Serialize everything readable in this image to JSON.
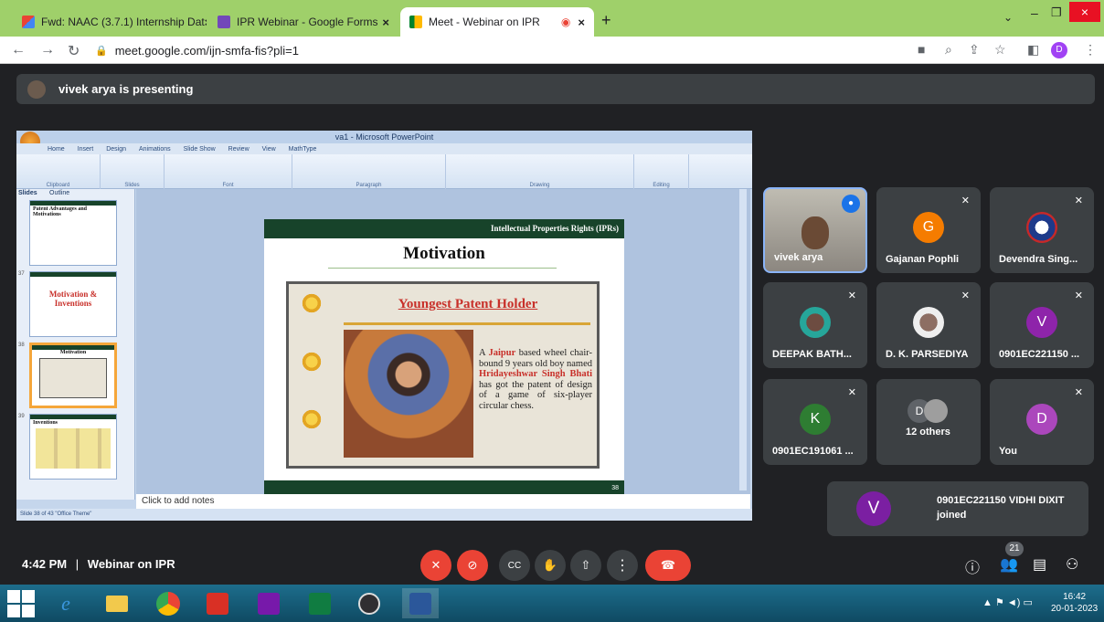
{
  "browser": {
    "tabs": [
      {
        "title": "Fwd: NAAC (3.7.1) Internship Dat",
        "icon": "gmail-icon"
      },
      {
        "title": "IPR Webinar - Google Forms",
        "icon": "forms-icon"
      },
      {
        "title": "Meet - Webinar on IPR",
        "icon": "meet-icon"
      }
    ],
    "url": "meet.google.com/ijn-smfa-fis?pli=1",
    "profile_initial": "D"
  },
  "meet": {
    "presenting_banner": "vivek arya is presenting",
    "time": "4:42 PM",
    "separator": "|",
    "meeting_title": "Webinar on IPR",
    "participant_count": "21",
    "toast": {
      "avatar": "V",
      "message": "0901EC221150 VIDHI DIXIT joined"
    },
    "tiles": [
      {
        "name": "vivek arya",
        "type": "video"
      },
      {
        "name": "Gajanan Pophli",
        "avatar": "G",
        "color": "#f57c00",
        "muted": true
      },
      {
        "name": "Devendra Sing...",
        "avatar": "",
        "color": "#c62828",
        "muted": true
      },
      {
        "name": "DEEPAK BATH...",
        "avatar": "",
        "color": "#26a69a",
        "muted": true
      },
      {
        "name": "D. K. PARSEDIYA",
        "avatar": "",
        "color": "#5d4037",
        "muted": true
      },
      {
        "name": "0901EC221150 ...",
        "avatar": "V",
        "color": "#8e24aa",
        "muted": true
      },
      {
        "name": "0901EC191061 ...",
        "avatar": "K",
        "color": "#2e7d32",
        "muted": true
      },
      {
        "name": "12 others",
        "avatar": "D",
        "color": "#5f6368",
        "muted": false
      },
      {
        "name": "You",
        "avatar": "D",
        "color": "#ab47bc",
        "muted": true
      }
    ]
  },
  "ppt": {
    "window_title": "va1 - Microsoft PowerPoint",
    "ribbon_tabs": [
      "Home",
      "Insert",
      "Design",
      "Animations",
      "Slide Show",
      "Review",
      "View",
      "MathType"
    ],
    "ribbon_groups": [
      "Clipboard",
      "Slides",
      "Font",
      "Paragraph",
      "Drawing",
      "Editing"
    ],
    "panel_tabs": [
      "Slides",
      "Outline"
    ],
    "thumbnails": [
      {
        "num": "",
        "title": "Patent Advantages and Motivations"
      },
      {
        "num": "37",
        "title": "Motivation & Inventions"
      },
      {
        "num": "38",
        "title": "Motivation"
      },
      {
        "num": "39",
        "title": "Inventions"
      }
    ],
    "slide": {
      "header": "Intellectual Properties Rights (IPRs)",
      "title": "Motivation",
      "subtitle": "Youngest Patent Holder",
      "text_1": "A",
      "text_red_1": "Jaipur",
      "text_2": "based wheel chair-bound 9 years old boy named",
      "text_red_2": "Hridayeshwar Singh Bhati",
      "text_3": "has got the patent of design of a game of six-player circular chess.",
      "page": "38"
    },
    "notes_placeholder": "Click to add notes",
    "status": "Slide 38 of 43   \"Office Theme\""
  },
  "taskbar": {
    "time": "16:42",
    "date": "20-01-2023"
  }
}
